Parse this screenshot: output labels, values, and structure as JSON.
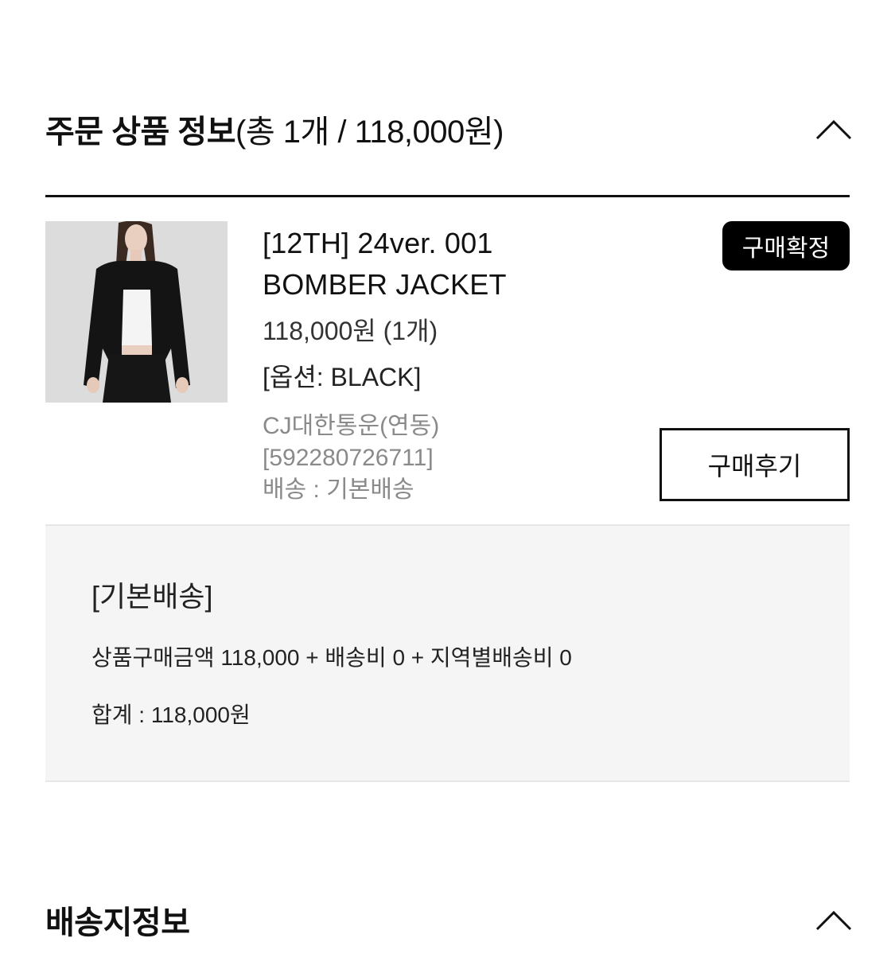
{
  "order_section": {
    "title_strong": "주문 상품 정보",
    "title_summary": "(총 1개 / 118,000원)",
    "collapse_icon": "chevron-up-icon"
  },
  "product": {
    "name_line1": "[12TH] 24ver. 001",
    "name_line2": "BOMBER JACKET",
    "price": "118,000원 (1개)",
    "option": "[옵션: BLACK]",
    "courier": "CJ대한통운(연동)",
    "tracking": "[592280726711]",
    "shipping": "배송 : 기본배송",
    "confirm_button": "구매확정",
    "review_button": "구매후기"
  },
  "summary": {
    "title": "[기본배송]",
    "formula": "상품구매금액 118,000 + 배송비 0 + 지역별배송비 0",
    "total": "합계 : 118,000원"
  },
  "shipping_section": {
    "title": "배송지정보",
    "collapse_icon": "chevron-up-icon"
  },
  "colors": {
    "text": "#111111",
    "muted": "#8a8a8a",
    "box_bg": "#f5f5f5",
    "button_dark": "#000000"
  }
}
